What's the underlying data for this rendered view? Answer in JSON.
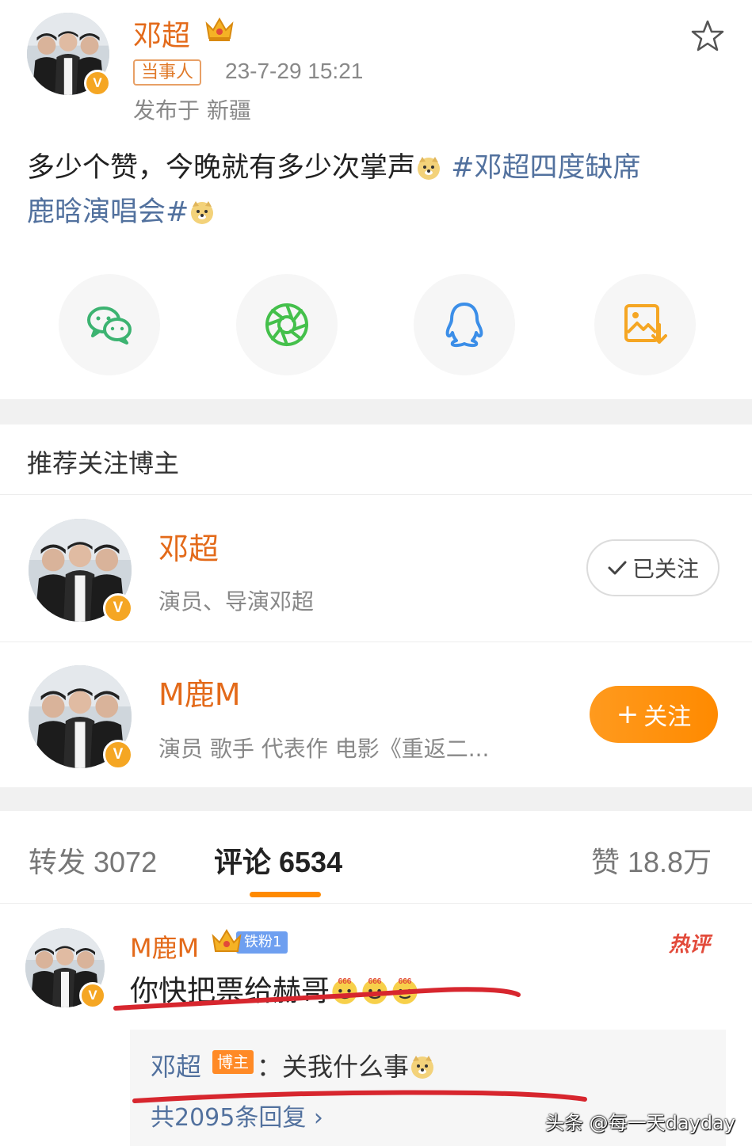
{
  "post": {
    "author": "邓超",
    "party_badge": "当事人",
    "time": "23-7-29 15:21",
    "location": "发布于 新疆",
    "text": "多少个赞，今晚就有多少次掌声",
    "hashtag_line1": "#邓超四度缺席",
    "hashtag_line2": "鹿晗演唱会#"
  },
  "share": {
    "icons": [
      "wechat-icon",
      "moments-icon",
      "qq-icon",
      "save-image-icon"
    ],
    "colors": {
      "wechat": "#3cb371",
      "moments": "#44c04b",
      "qq": "#3b8ee8",
      "save": "#f5a623"
    }
  },
  "recommend": {
    "title": "推荐关注博主",
    "items": [
      {
        "name": "邓超",
        "desc": "演员、导演邓超",
        "button": "已关注"
      },
      {
        "name": "M鹿M",
        "desc": "演员 歌手 代表作 电影《重返二...",
        "button": "关注"
      }
    ]
  },
  "tabs": {
    "reposts": "转发 3072",
    "comments": "评论 6534",
    "likes": "赞 18.8万"
  },
  "comment": {
    "author": "M鹿M",
    "fan_badge": "铁粉1",
    "hot_label": "热评",
    "text": "你快把票给赫哥",
    "reply": {
      "author": "邓超",
      "badge": "博主",
      "text": "：关我什么事",
      "count": "共2095条回复 ›"
    }
  },
  "watermark": "头条 @每一天dayday",
  "colors": {
    "accent": "#ff8a00",
    "name": "#e36a1a",
    "link": "#52719e",
    "annotation": "#d7262e"
  }
}
